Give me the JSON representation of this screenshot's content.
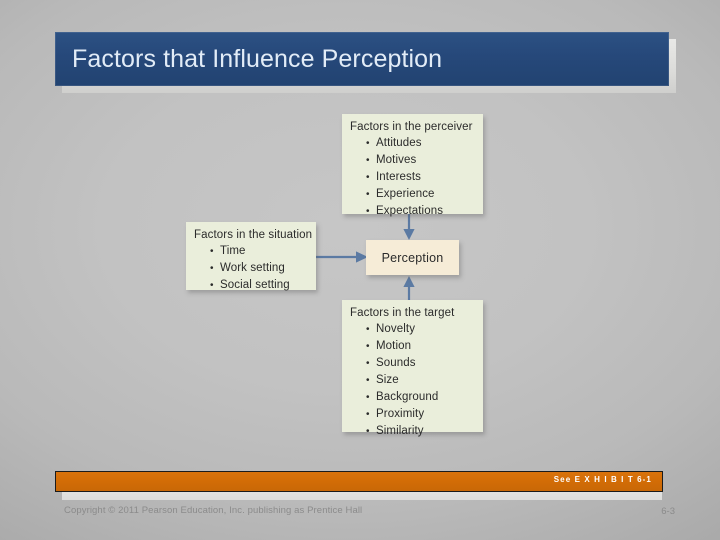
{
  "slide": {
    "title": "Factors that Influence Perception",
    "title_bg": "#26487a",
    "accent_orange": "#d26c06"
  },
  "diagram": {
    "center": {
      "label": "Perception",
      "fill": "#f6ecd7"
    },
    "box_fill": "#eaeedb",
    "arrow_color": "#5b7aa3",
    "boxes": [
      {
        "id": "perceiver",
        "heading": "Factors in the perceiver",
        "items": [
          "Attitudes",
          "Motives",
          "Interests",
          "Experience",
          "Expectations"
        ]
      },
      {
        "id": "situation",
        "heading": "Factors in the situation",
        "items": [
          "Time",
          "Work setting",
          "Social setting"
        ]
      },
      {
        "id": "target",
        "heading": "Factors in the target",
        "items": [
          "Novelty",
          "Motion",
          "Sounds",
          "Size",
          "Background",
          "Proximity",
          "Similarity"
        ]
      }
    ]
  },
  "footer": {
    "exhibit": "See E X H I B I T  6-1",
    "copyright": "Copyright © 2011 Pearson Education, Inc. publishing as Prentice Hall",
    "page_number": "6-3"
  }
}
